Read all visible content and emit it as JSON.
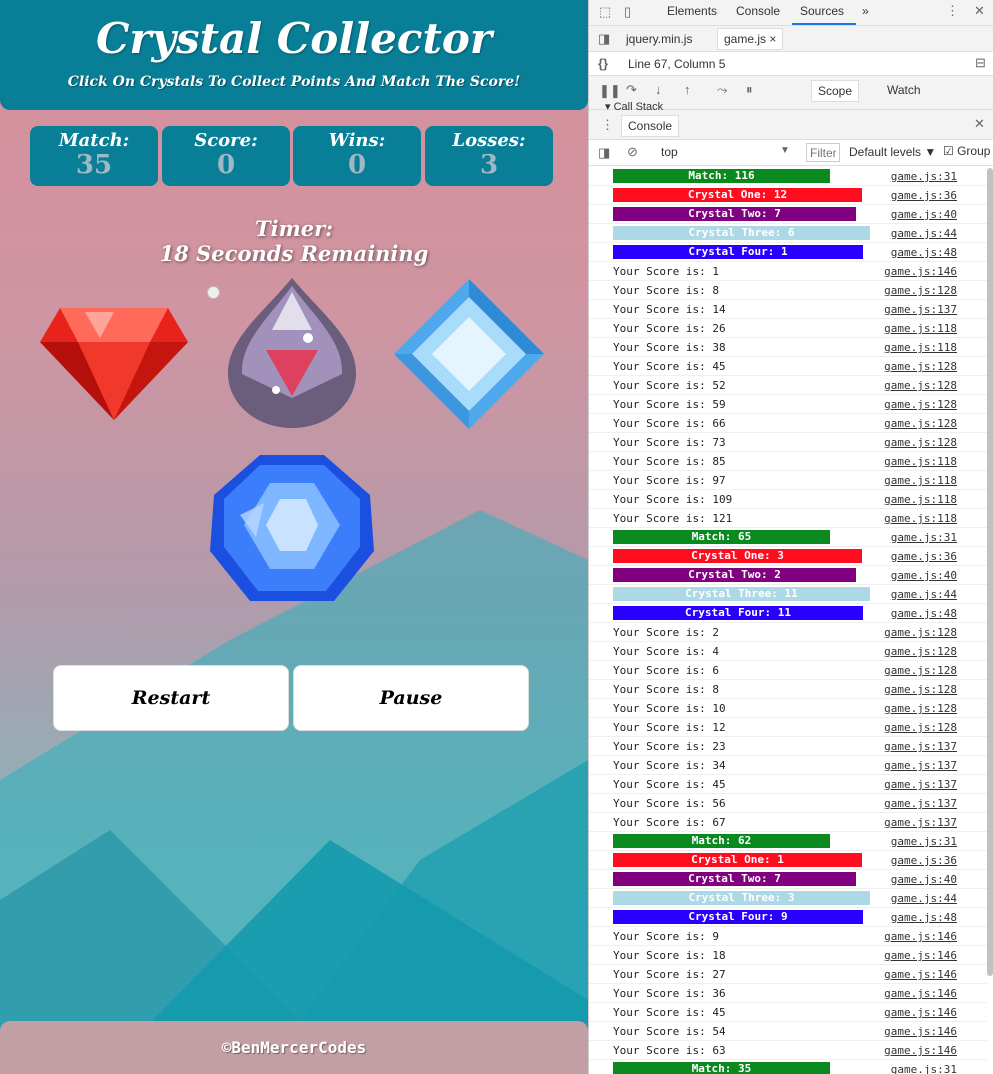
{
  "game": {
    "title": "Crystal Collector",
    "subtitle": "Click On Crystals To Collect Points And Match The Score!",
    "stats": [
      {
        "label": "Match:",
        "value": "35"
      },
      {
        "label": "Score:",
        "value": "0"
      },
      {
        "label": "Wins:",
        "value": "0"
      },
      {
        "label": "Losses:",
        "value": "3"
      }
    ],
    "timer_label": "Timer:",
    "timer_value": "18 Seconds Remaining",
    "buttons": {
      "restart": "Restart",
      "pause": "Pause"
    },
    "footer": "©BenMercerCodes",
    "colors": {
      "header": "#087f97",
      "red_crystal": "#e8231c",
      "blue_crystal": "#3b7dfb",
      "diamond": "#7cc7f4"
    }
  },
  "devtools": {
    "tabs": [
      "Elements",
      "Console",
      "Sources",
      "»"
    ],
    "active_tab": "Sources",
    "files": [
      "jquery.min.js",
      "game.js"
    ],
    "location": "Line 67, Column 5",
    "scope_tabs": [
      "Scope",
      "Watch"
    ],
    "call_stack": "Call Stack",
    "drawer_tab": "Console",
    "filter": {
      "context": "top",
      "placeholder": "Filter",
      "levels": "Default levels",
      "group": "Group"
    },
    "bar_colors": {
      "match": "#0a8a1e",
      "one": "#ff0d1e",
      "two": "#800080",
      "three": "#add8e6",
      "four": "#2800ff"
    },
    "log": [
      {
        "type": "match",
        "text": "Match: 116",
        "src": "game.js:31"
      },
      {
        "type": "one",
        "text": "Crystal One: 12",
        "src": "game.js:36"
      },
      {
        "type": "two",
        "text": "Crystal Two: 7",
        "src": "game.js:40"
      },
      {
        "type": "three",
        "text": "Crystal Three: 6",
        "src": "game.js:44"
      },
      {
        "type": "four",
        "text": "Crystal Four: 1",
        "src": "game.js:48"
      },
      {
        "type": "text",
        "text": "Your Score is: 1",
        "src": "game.js:146"
      },
      {
        "type": "text",
        "text": "Your Score is: 8",
        "src": "game.js:128"
      },
      {
        "type": "text",
        "text": "Your Score is: 14",
        "src": "game.js:137"
      },
      {
        "type": "text",
        "text": "Your Score is: 26",
        "src": "game.js:118"
      },
      {
        "type": "text",
        "text": "Your Score is: 38",
        "src": "game.js:118"
      },
      {
        "type": "text",
        "text": "Your Score is: 45",
        "src": "game.js:128"
      },
      {
        "type": "text",
        "text": "Your Score is: 52",
        "src": "game.js:128"
      },
      {
        "type": "text",
        "text": "Your Score is: 59",
        "src": "game.js:128"
      },
      {
        "type": "text",
        "text": "Your Score is: 66",
        "src": "game.js:128"
      },
      {
        "type": "text",
        "text": "Your Score is: 73",
        "src": "game.js:128"
      },
      {
        "type": "text",
        "text": "Your Score is: 85",
        "src": "game.js:118"
      },
      {
        "type": "text",
        "text": "Your Score is: 97",
        "src": "game.js:118"
      },
      {
        "type": "text",
        "text": "Your Score is: 109",
        "src": "game.js:118"
      },
      {
        "type": "text",
        "text": "Your Score is: 121",
        "src": "game.js:118"
      },
      {
        "type": "match",
        "text": "Match: 65",
        "src": "game.js:31"
      },
      {
        "type": "one",
        "text": "Crystal One: 3",
        "src": "game.js:36"
      },
      {
        "type": "two",
        "text": "Crystal Two: 2",
        "src": "game.js:40"
      },
      {
        "type": "three",
        "text": "Crystal Three: 11",
        "src": "game.js:44"
      },
      {
        "type": "four",
        "text": "Crystal Four: 11",
        "src": "game.js:48"
      },
      {
        "type": "text",
        "text": "Your Score is: 2",
        "src": "game.js:128"
      },
      {
        "type": "text",
        "text": "Your Score is: 4",
        "src": "game.js:128"
      },
      {
        "type": "text",
        "text": "Your Score is: 6",
        "src": "game.js:128"
      },
      {
        "type": "text",
        "text": "Your Score is: 8",
        "src": "game.js:128"
      },
      {
        "type": "text",
        "text": "Your Score is: 10",
        "src": "game.js:128"
      },
      {
        "type": "text",
        "text": "Your Score is: 12",
        "src": "game.js:128"
      },
      {
        "type": "text",
        "text": "Your Score is: 23",
        "src": "game.js:137"
      },
      {
        "type": "text",
        "text": "Your Score is: 34",
        "src": "game.js:137"
      },
      {
        "type": "text",
        "text": "Your Score is: 45",
        "src": "game.js:137"
      },
      {
        "type": "text",
        "text": "Your Score is: 56",
        "src": "game.js:137"
      },
      {
        "type": "text",
        "text": "Your Score is: 67",
        "src": "game.js:137"
      },
      {
        "type": "match",
        "text": "Match: 62",
        "src": "game.js:31"
      },
      {
        "type": "one",
        "text": "Crystal One: 1",
        "src": "game.js:36"
      },
      {
        "type": "two",
        "text": "Crystal Two: 7",
        "src": "game.js:40"
      },
      {
        "type": "three",
        "text": "Crystal Three: 3",
        "src": "game.js:44"
      },
      {
        "type": "four",
        "text": "Crystal Four: 9",
        "src": "game.js:48"
      },
      {
        "type": "text",
        "text": "Your Score is: 9",
        "src": "game.js:146"
      },
      {
        "type": "text",
        "text": "Your Score is: 18",
        "src": "game.js:146"
      },
      {
        "type": "text",
        "text": "Your Score is: 27",
        "src": "game.js:146"
      },
      {
        "type": "text",
        "text": "Your Score is: 36",
        "src": "game.js:146"
      },
      {
        "type": "text",
        "text": "Your Score is: 45",
        "src": "game.js:146"
      },
      {
        "type": "text",
        "text": "Your Score is: 54",
        "src": "game.js:146"
      },
      {
        "type": "text",
        "text": "Your Score is: 63",
        "src": "game.js:146"
      },
      {
        "type": "match",
        "text": "Match: 35",
        "src": "game.js:31"
      }
    ]
  }
}
